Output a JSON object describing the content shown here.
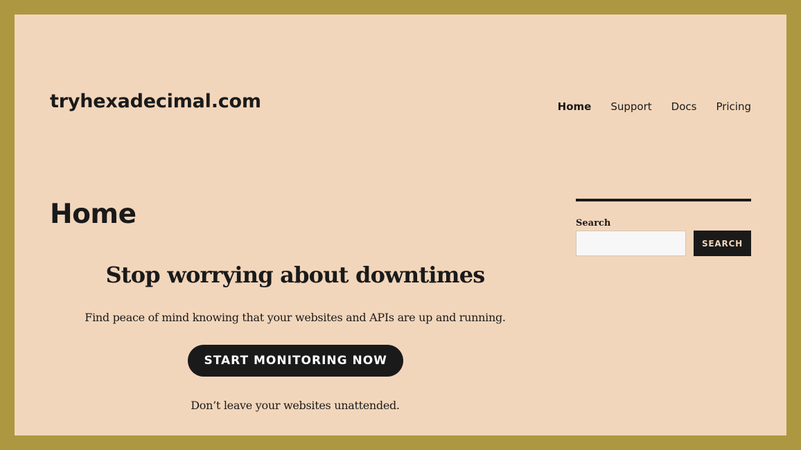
{
  "site": {
    "title": "tryhexadecimal.com"
  },
  "nav": {
    "items": [
      {
        "label": "Home",
        "active": true
      },
      {
        "label": "Support",
        "active": false
      },
      {
        "label": "Docs",
        "active": false
      },
      {
        "label": "Pricing",
        "active": false
      }
    ]
  },
  "main": {
    "page_title": "Home",
    "hero": {
      "heading": "Stop worrying about downtimes",
      "lead": "Find peace of mind knowing that your websites and APIs are up and running.",
      "cta_label": "START MONITORING NOW",
      "tagline": "Don’t leave your websites unattended."
    }
  },
  "sidebar": {
    "search": {
      "label": "Search",
      "value": "",
      "placeholder": "",
      "button_label": "SEARCH"
    }
  },
  "colors": {
    "frame": "#ad9841",
    "background": "#f2d6bb",
    "text": "#1a1a1a",
    "button_bg": "#1a1a1a"
  }
}
